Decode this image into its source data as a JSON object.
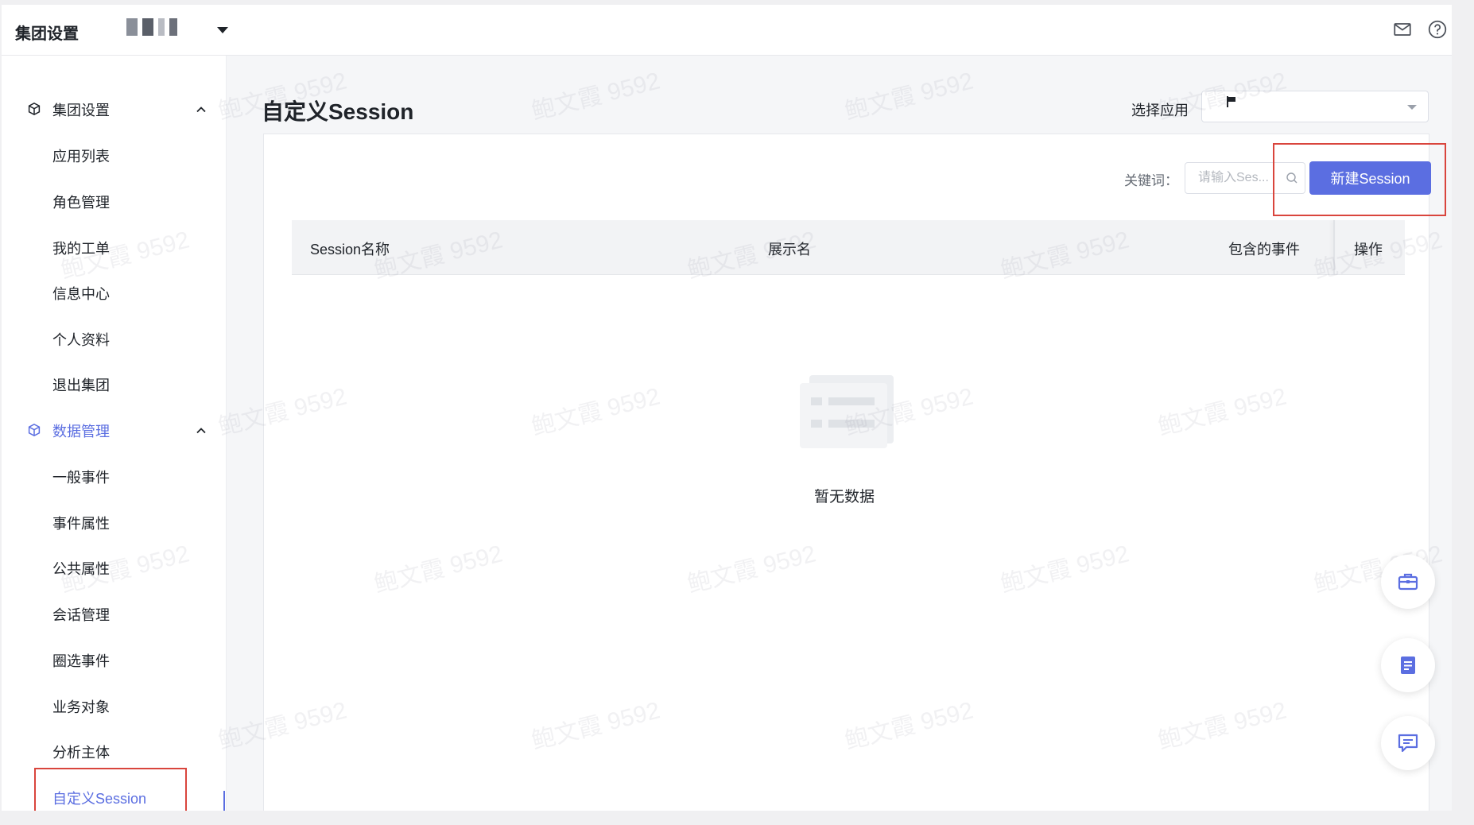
{
  "topbar": {
    "title": "集团设置",
    "icons": [
      "mail-icon",
      "help-icon"
    ]
  },
  "sidebar": {
    "groups": [
      {
        "label": "集团设置",
        "icon": "cube-icon",
        "items": [
          "应用列表",
          "角色管理",
          "我的工单",
          "信息中心",
          "个人资料",
          "退出集团"
        ]
      },
      {
        "label": "数据管理",
        "icon": "cube-icon",
        "items": [
          "一般事件",
          "事件属性",
          "公共属性",
          "会话管理",
          "圈选事件",
          "业务对象",
          "分析主体",
          "自定义Session"
        ]
      }
    ],
    "active_item": "自定义Session"
  },
  "main": {
    "page_title": "自定义Session",
    "select_label": "选择应用",
    "select_value": "",
    "keyword_label": "关键词：",
    "keyword_placeholder": "请输入Ses...",
    "new_button": "新建Session",
    "table": {
      "columns": [
        "Session名称",
        "展示名",
        "包含的事件",
        "操作"
      ],
      "rows": []
    },
    "empty_text": "暂无数据"
  },
  "floating_buttons": [
    "toolbox-icon",
    "document-icon",
    "chat-icon"
  ],
  "colors": {
    "accent": "#5b6ee1",
    "highlight_box": "#d9453d"
  },
  "watermark": "鲍文霞 9592"
}
